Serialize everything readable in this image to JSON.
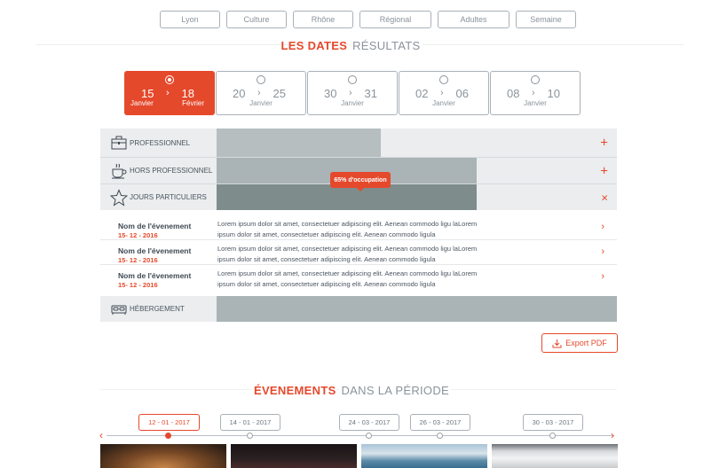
{
  "filters": [
    "Lyon",
    "Culture",
    "Rhône",
    "Régional",
    "Adultes",
    "Semaine"
  ],
  "dates_section": {
    "highlight": "LES DATES",
    "rest": "RÉSULTATS"
  },
  "periods": [
    {
      "start": "15",
      "end": "18",
      "month_start": "Janvier",
      "month_end": "Février",
      "selected": true
    },
    {
      "start": "20",
      "end": "25",
      "month": "Janvier",
      "selected": false
    },
    {
      "start": "30",
      "end": "31",
      "month": "Janvier",
      "selected": false
    },
    {
      "start": "02",
      "end": "06",
      "month": "Janvier",
      "selected": false
    },
    {
      "start": "08",
      "end": "10",
      "month": "Janvier",
      "selected": false
    }
  ],
  "categories": [
    {
      "label": "PROFESSIONNEL",
      "icon": "briefcase-icon",
      "occupancy": 0.41,
      "action": "+",
      "bar_color": "#b7bec0"
    },
    {
      "label": "HORS PROFESSIONNEL",
      "icon": "coffee-cup-icon",
      "occupancy": 0.65,
      "action": "+",
      "bar_color": "#aab3b5"
    },
    {
      "label": "JOURS PARTICULIERS",
      "icon": "star-icon",
      "occupancy": 0.65,
      "action": "×",
      "bar_color": "#7f8c8c"
    }
  ],
  "occupancy_tooltip": "65% d'occupation",
  "events": [
    {
      "name": "Nom de l'évenement",
      "date": "15- 12 - 2016",
      "line1": "Lorem ipsum dolor sit amet, consectetuer adipiscing elit. Aenean commodo ligu laLorem",
      "line2": "ipsum dolor sit amet, consectetuer adipiscing elit. Aenean commodo ligula"
    },
    {
      "name": "Nom de l'évenement",
      "date": "15- 12 - 2016",
      "line1": "Lorem ipsum dolor sit amet, consectetuer adipiscing elit. Aenean commodo ligu laLorem",
      "line2": "ipsum dolor sit amet, consectetuer adipiscing elit. Aenean commodo ligula"
    },
    {
      "name": "Nom de l'évenement",
      "date": "15- 12 - 2016",
      "line1": "Lorem ipsum dolor sit amet, consectetuer adipiscing elit. Aenean commodo ligu laLorem",
      "line2": "ipsum dolor sit amet, consectetuer adipiscing elit. Aenean commodo ligula"
    }
  ],
  "lodging": {
    "label": "HÉBERGEMENT",
    "icon": "bed-icon",
    "occupancy": 1.0,
    "bar_color": "#aab3b5"
  },
  "export_label": "Export PDF",
  "events_section": {
    "highlight": "ÉVENEMENTS",
    "rest": "DANS LA PÉRIODE"
  },
  "timeline": [
    {
      "date": "12 - 01 - 2017",
      "active": true
    },
    {
      "date": "14 - 01 - 2017",
      "active": false
    },
    {
      "date": "24 - 03 - 2017",
      "active": false
    },
    {
      "date": "26 - 03 - 2017",
      "active": false
    },
    {
      "date": "30 - 03 - 2017",
      "active": false
    }
  ],
  "colors": {
    "accent": "#e5492c",
    "panel": "#ebedee"
  }
}
